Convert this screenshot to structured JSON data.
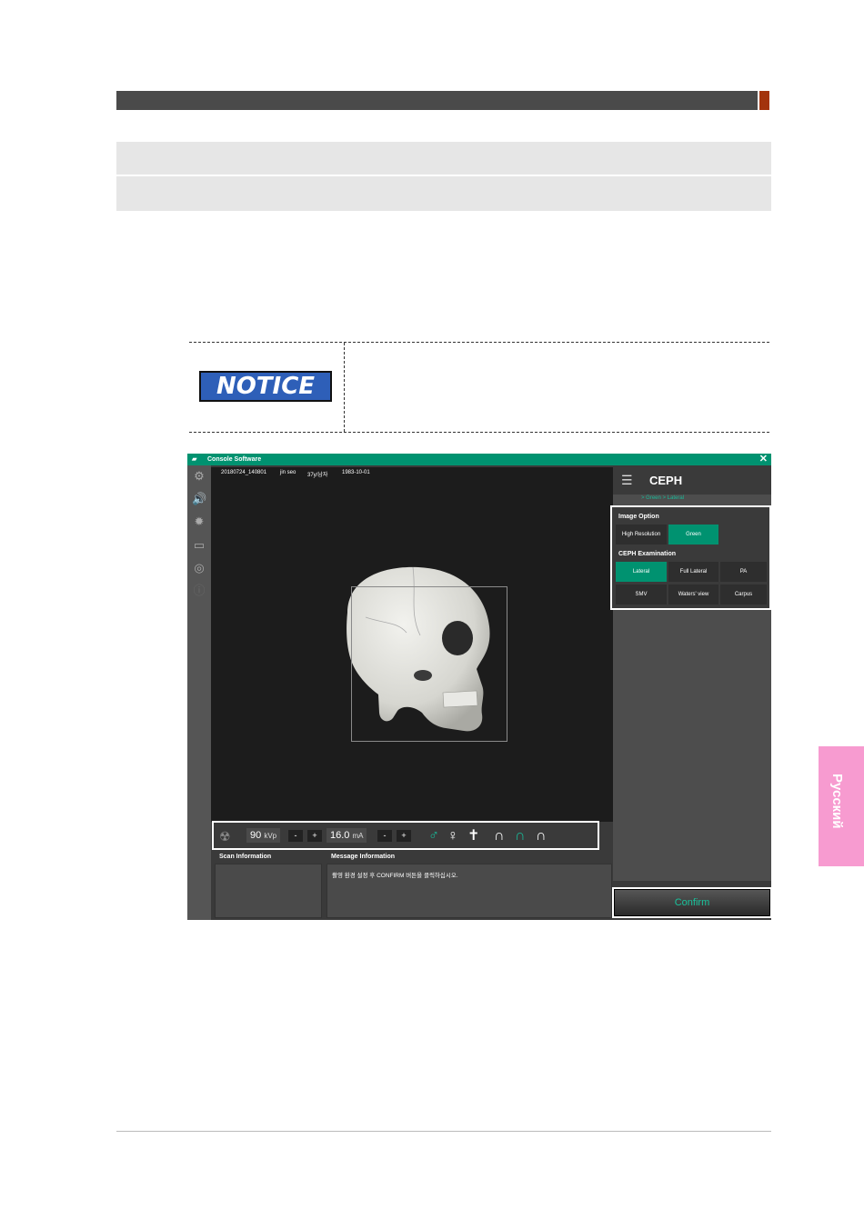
{
  "notice": {
    "badge": "NOTICE"
  },
  "window": {
    "title": "Console Software",
    "close": "✕"
  },
  "patient": {
    "id": "20180724_140801",
    "name": "jin seo",
    "age_sex": "37y/남자",
    "birth": "1983-10-01"
  },
  "exposure": {
    "kvp": "90",
    "kvp_unit": "kVp",
    "ma": "16.0",
    "ma_unit": "mA",
    "minus": "-",
    "plus": "+"
  },
  "panels": {
    "scan_label": "Scan Information",
    "message_label": "Message Information",
    "message_text": "촬영 환경 설정 후 CONFIRM 버튼을 클릭하십시오."
  },
  "ceph_panel": {
    "title": "CEPH",
    "breadcrumb": "> Green > Lateral",
    "image_option_label": "Image Option",
    "image_options": [
      "High Resolution",
      "Green"
    ],
    "exam_label": "CEPH Examination",
    "exams": [
      "Lateral",
      "Full Lateral",
      "PA",
      "SMV",
      "Waters' view",
      "Carpus"
    ],
    "confirm": "Confirm"
  },
  "language_tab": "Русский",
  "colors": {
    "accent": "#009270",
    "header_accent": "#a3330c",
    "language_tab": "#f79bd0"
  }
}
